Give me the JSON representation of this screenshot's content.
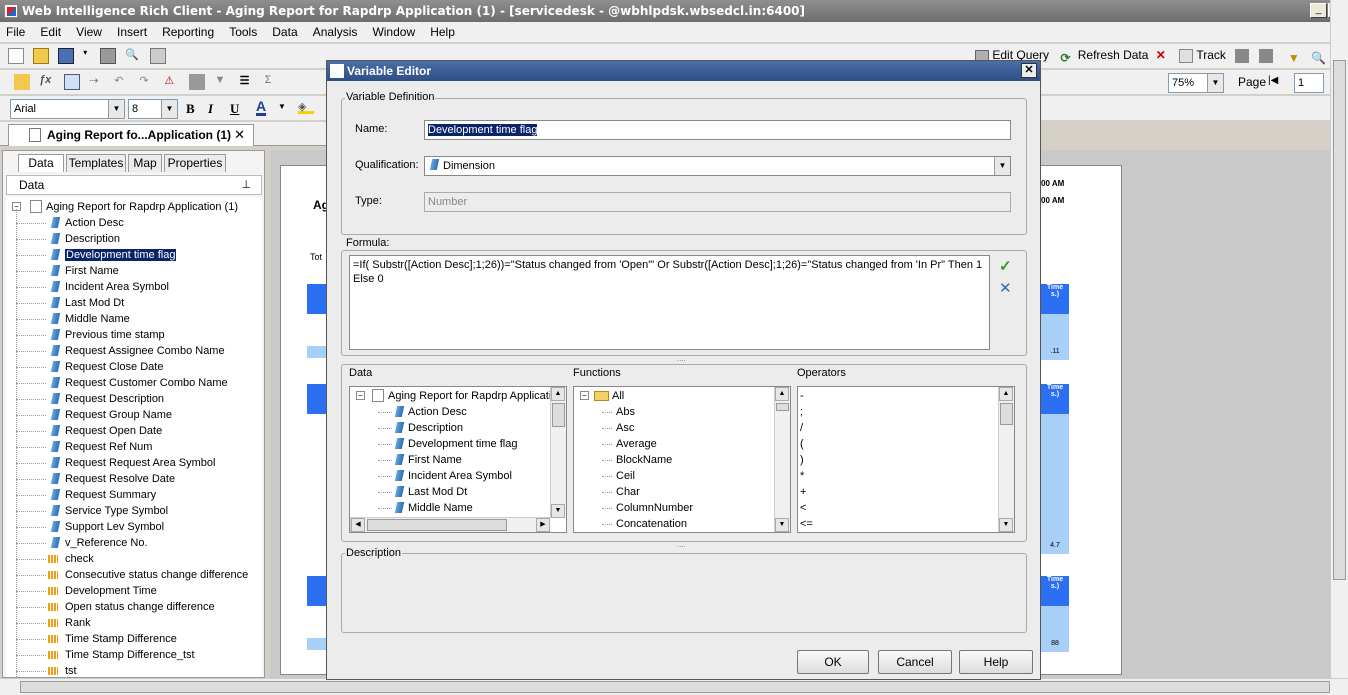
{
  "window": {
    "title": "Web Intelligence Rich Client - Aging Report for Rapdrp Application (1) - [servicedesk - @wbhlpdsk.wbsedcl.in:6400]"
  },
  "menu": [
    "File",
    "Edit",
    "View",
    "Insert",
    "Reporting",
    "Tools",
    "Data",
    "Analysis",
    "Window",
    "Help"
  ],
  "toolbar_right": {
    "edit_query": "Edit Query",
    "refresh_data": "Refresh Data",
    "track": "Track",
    "zoom": "75%",
    "page_label": "Page",
    "page_value": "1"
  },
  "format_bar": {
    "font": "Arial",
    "size": "8"
  },
  "document_tab": "Aging Report fo...Application (1)",
  "left_panel": {
    "tabs": [
      "Data",
      "Templates",
      "Map",
      "Properties"
    ],
    "header": "Data",
    "root": "Aging Report for Rapdrp Application (1)",
    "dimensions": [
      "Action Desc",
      "Description",
      "Development time flag",
      "First Name",
      "Incident Area Symbol",
      "Last Mod Dt",
      "Middle Name",
      "Previous time stamp",
      "Request Assignee Combo Name",
      "Request Close Date",
      "Request Customer Combo Name",
      "Request Description",
      "Request Group Name",
      "Request Open Date",
      "Request Ref Num",
      "Request Request Area Symbol",
      "Request Resolve Date",
      "Request Summary",
      "Service Type Symbol",
      "Support Lev Symbol",
      "v_Reference No."
    ],
    "measures": [
      "check",
      "Consecutive status change difference",
      "Development Time",
      "Open status change difference",
      "Rank",
      "Time Stamp Difference",
      "Time Stamp Difference_tst",
      "tst"
    ],
    "selected": "Development time flag"
  },
  "report_fragments": {
    "time1": "00 AM",
    "time2": "00 AM",
    "ag": "Ag",
    "tot": "Tot",
    "col_header_1": "Time",
    "col_header_2": "s.)",
    "val1": ".11",
    "val2": "4.7",
    "val3": "88"
  },
  "dialog": {
    "title": "Variable Editor",
    "definition_label": "Variable Definition",
    "name_label": "Name:",
    "name_value": "Development time flag",
    "qualification_label": "Qualification:",
    "qualification_value": "Dimension",
    "type_label": "Type:",
    "type_value": "Number",
    "formula_label": "Formula:",
    "formula_line1": "=If( Substr([Action Desc];1;26))=\"Status changed from 'Open'\" Or Substr([Action Desc];1;26)=\"Status changed from 'In Pr\" Then 1",
    "formula_line2": "Else 0",
    "data_label": "Data",
    "functions_label": "Functions",
    "operators_label": "Operators",
    "data_root": "Aging Report for Rapdrp Applicati",
    "data_items": [
      "Action Desc",
      "Description",
      "Development time flag",
      "First Name",
      "Incident Area Symbol",
      "Last Mod Dt",
      "Middle Name"
    ],
    "functions_root": "All",
    "functions": [
      "Abs",
      "Asc",
      "Average",
      "BlockName",
      "Ceil",
      "Char",
      "ColumnNumber",
      "Concatenation"
    ],
    "operators": [
      "-",
      ";",
      "/",
      "(",
      ")",
      "*",
      "+",
      "<",
      "<="
    ],
    "description_label": "Description",
    "ok": "OK",
    "cancel": "Cancel",
    "help": "Help"
  }
}
